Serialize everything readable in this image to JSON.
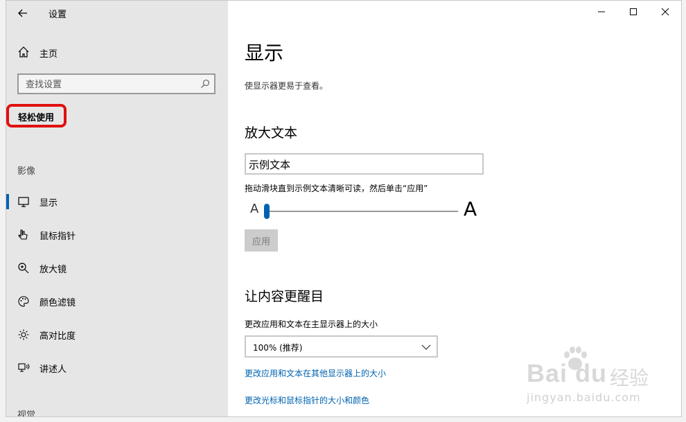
{
  "app": {
    "title": "设置"
  },
  "sidebar": {
    "home_label": "主页",
    "search_placeholder": "查找设置",
    "section_title": "轻松使用",
    "group_vision": "影像",
    "items": [
      {
        "label": "显示",
        "icon": "monitor-icon",
        "active": true
      },
      {
        "label": "鼠标指针",
        "icon": "mouse-pointer-icon",
        "active": false
      },
      {
        "label": "放大镜",
        "icon": "magnifier-icon",
        "active": false
      },
      {
        "label": "颜色滤镜",
        "icon": "palette-icon",
        "active": false
      },
      {
        "label": "高对比度",
        "icon": "sun-icon",
        "active": false
      },
      {
        "label": "讲述人",
        "icon": "narrator-icon",
        "active": false
      }
    ],
    "group_next": "视觉"
  },
  "main": {
    "title": "显示",
    "description": "使显示器更易于查看。",
    "enlarge_text": {
      "title": "放大文本",
      "sample_text": "示例文本",
      "instruction": "拖动滑块直到示例文本清晰可读，然后单击“应用”",
      "slider_min_label": "A",
      "slider_max_label": "A",
      "slider_value_fraction": 0.0,
      "apply_label": "应用"
    },
    "make_bigger": {
      "title": "让内容更醒目",
      "scale_label": "更改应用和文本在主显示器上的大小",
      "scale_value": "100% (推荐)",
      "link_other_displays": "更改应用和文本在其他显示器上的大小",
      "link_cursor": "更改光标和鼠标指针的大小和颜色"
    }
  },
  "watermark": {
    "logo_text": "Bai du",
    "brand_text": "经验",
    "url_text": "jingyan.baidu.com"
  },
  "colors": {
    "accent": "#0063b1",
    "highlight": "#e01010",
    "sidebar_bg": "#e6e6e6"
  }
}
